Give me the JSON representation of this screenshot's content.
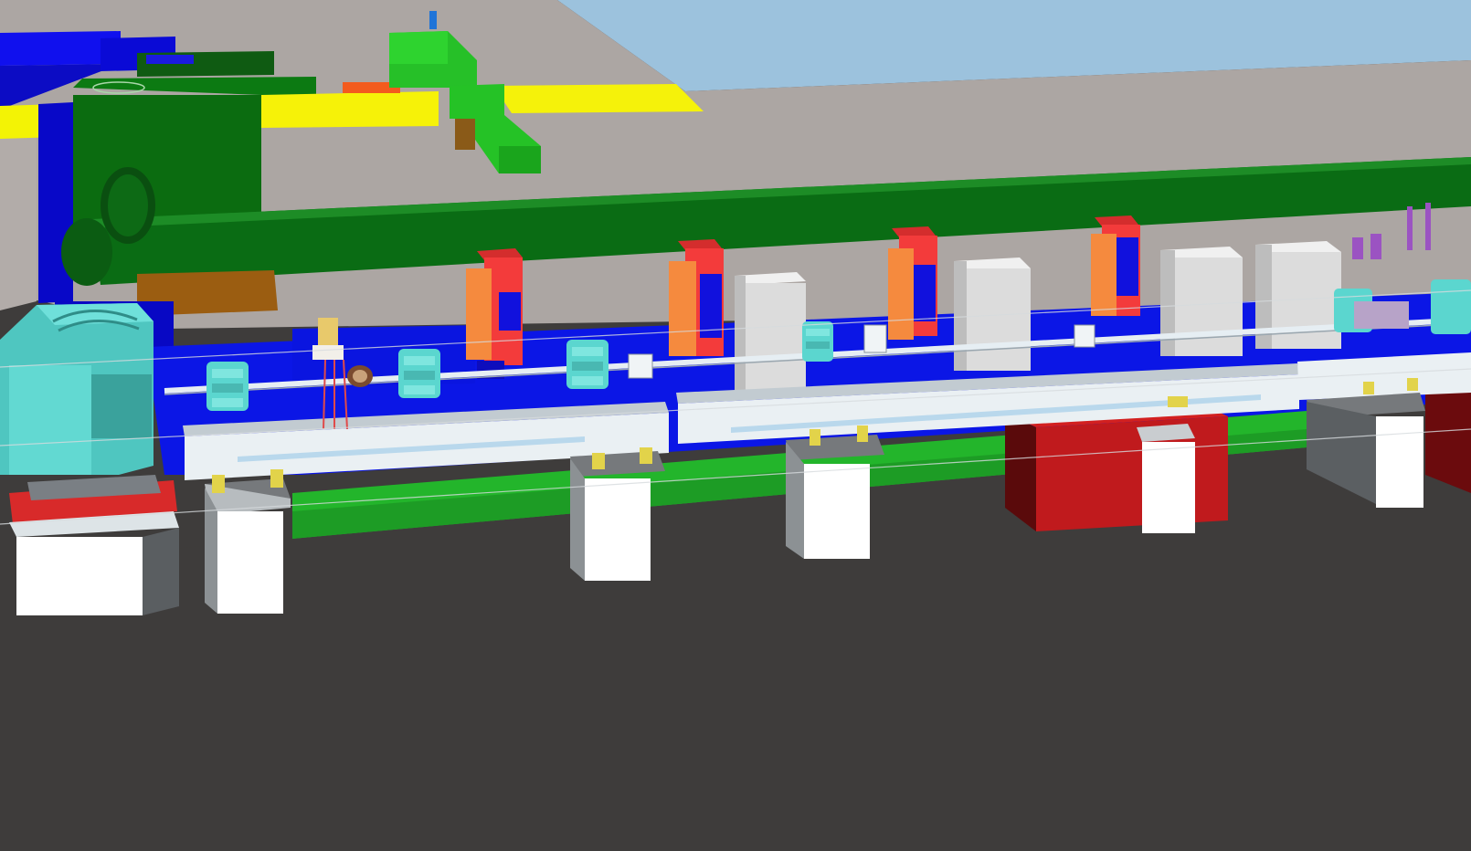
{
  "scene": {
    "view": "3d-cad-render",
    "subject": "accelerator-beamline-section",
    "colors": {
      "floor": "#3e3c3b",
      "back_wall": "#aca6a3",
      "ceiling_sky": "#9cc2dd",
      "trench_blue": "#0a17ea",
      "trench_green": "#22b32c",
      "cooling_pipe": "#0b6e16",
      "girder": "#dfe6ea",
      "pedestal": "#ffffff",
      "magnet_cyan": "#5bd6cf",
      "rf_box_orange": "#f58a3e",
      "rf_box_red": "#f03a3a",
      "cabinet_grey": "#d9d9d9",
      "shield_block_red": "#b6161b"
    },
    "icons": [
      "bending-magnet-icon",
      "quadrupole-magnet-icon",
      "rf-cavity-icon",
      "vacuum-pump-icon",
      "support-pedestal-icon"
    ]
  }
}
